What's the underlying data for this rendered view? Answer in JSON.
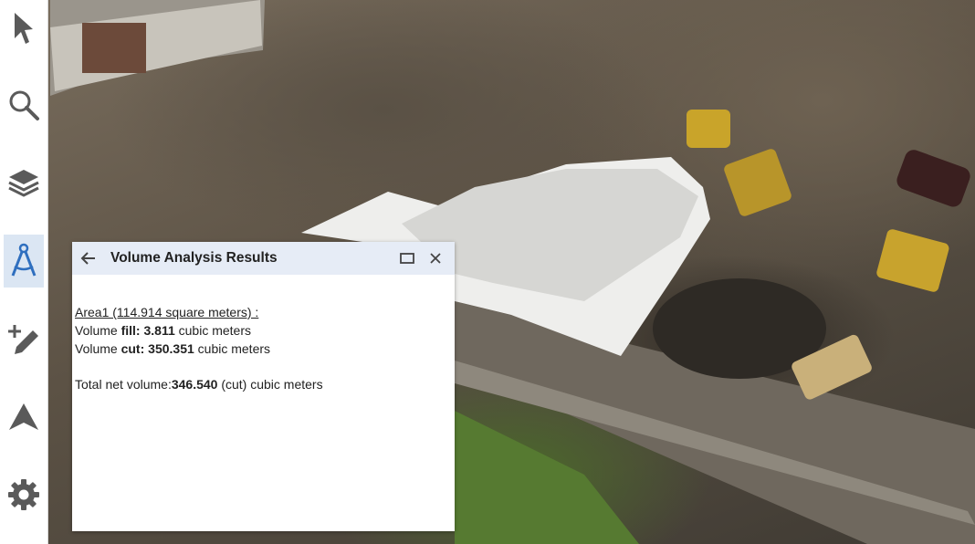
{
  "toolbar": {
    "tools": [
      {
        "icon": "select-arrow-icon",
        "active": false
      },
      {
        "icon": "search-icon",
        "active": false
      },
      {
        "icon": "layers-icon",
        "active": false
      },
      {
        "icon": "measure-compass-icon",
        "active": true
      },
      {
        "icon": "add-edit-pencil-icon",
        "active": false
      },
      {
        "icon": "navigation-arrow-icon",
        "active": false
      },
      {
        "icon": "settings-gear-icon",
        "active": false
      }
    ],
    "active_color": "#2f6fbf"
  },
  "panel": {
    "title": "Volume Analysis Results",
    "back_icon": "back-arrow-icon",
    "maximize_icon": "maximize-icon",
    "close_icon": "close-icon",
    "area_label": "Area1 (114.914 square meters) :",
    "fill": {
      "prefix": "Volume ",
      "label": "fill:",
      "value": "3.811",
      "unit": " cubic meters"
    },
    "cut": {
      "prefix": "Volume ",
      "label": "cut:",
      "value": "350.351",
      "unit": " cubic meters"
    },
    "net": {
      "label": "Total net volume:",
      "value": "346.540",
      "suffix": " (cut) cubic meters"
    }
  }
}
